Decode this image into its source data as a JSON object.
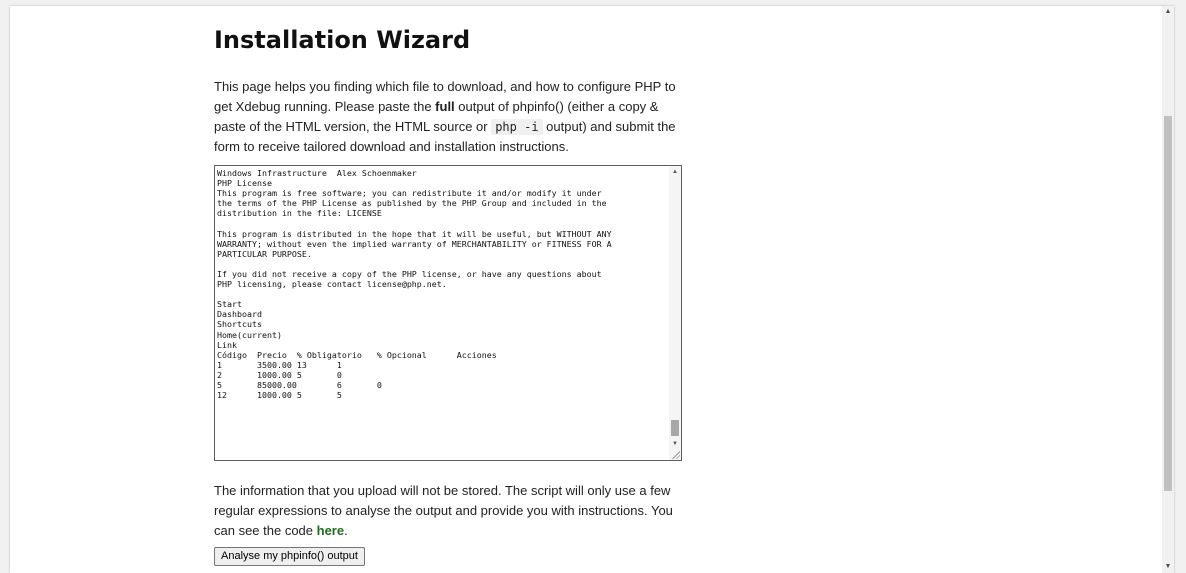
{
  "page": {
    "title": "Installation Wizard",
    "intro": {
      "p1": "This page helps you finding which file to download, and how to configure PHP to get Xdebug running. Please paste the ",
      "bold": "full",
      "p2": " output of phpinfo() (either a copy & paste of the HTML version, the HTML source or ",
      "code": "php -i",
      "p3": " output) and submit the form to receive tailored download and installation instructions."
    },
    "textarea_value": "Windows Infrastructure  Alex Schoenmaker\nPHP License\nThis program is free software; you can redistribute it and/or modify it under\nthe terms of the PHP License as published by the PHP Group and included in the\ndistribution in the file: LICENSE\n\nThis program is distributed in the hope that it will be useful, but WITHOUT ANY\nWARRANTY; without even the implied warranty of MERCHANTABILITY or FITNESS FOR A\nPARTICULAR PURPOSE.\n\nIf you did not receive a copy of the PHP license, or have any questions about\nPHP licensing, please contact license@php.net.\n\nStart\nDashboard\nShortcuts\nHome(current)\nLink\nCódigo  Precio  % Obligatorio   % Opcional      Acciones\n1       3500.00 13      1\n2       1000.00 5       0\n5       85000.00        6       0\n12      1000.00 5       5\n\n",
    "info": {
      "p1": "The information that you upload will not be stored. The script will only use a few regular expressions to analyse the output and provide you with instructions. You can see the code ",
      "link": "here",
      "p2": "."
    },
    "submit_label": "Analyse my phpinfo() output"
  },
  "icons": {
    "scroll_up": "arrow-up-icon",
    "scroll_down": "arrow-down-icon",
    "resize": "resize-grip-icon"
  },
  "colors": {
    "link": "#1e6e1e"
  }
}
